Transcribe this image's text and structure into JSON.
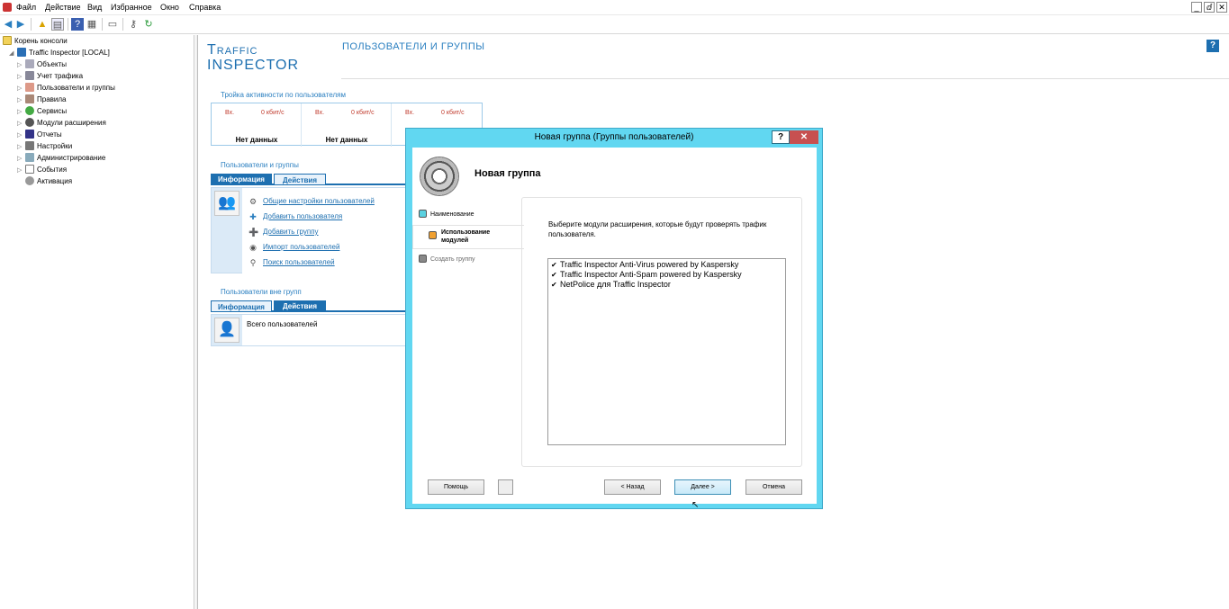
{
  "menubar": {
    "items": [
      "Файл",
      "Действие",
      "Вид",
      "Избранное",
      "Окно",
      "Справка"
    ],
    "window_controls": [
      "_",
      "ⅆ",
      "✕"
    ]
  },
  "tree": {
    "root": "Корень консоли",
    "server": "Traffic Inspector [LOCAL]",
    "items": [
      "Объекты",
      "Учет трафика",
      "Пользователи и группы",
      "Правила",
      "Сервисы",
      "Модули расширения",
      "Отчеты",
      "Настройки",
      "Администрирование",
      "События",
      "Активация"
    ]
  },
  "header": {
    "logo_line1": "Traffic",
    "logo_line2": "Inspector",
    "page_title": "ПОЛЬЗОВАТЕЛИ И ГРУППЫ",
    "help": "?"
  },
  "troika": {
    "title": "Тройка активности по пользователям",
    "cells": [
      {
        "vx": "Вх.",
        "speed": "0 кбит/с",
        "no_data": "Нет данных"
      },
      {
        "vx": "Вх.",
        "speed": "0 кбит/с",
        "no_data": "Нет данных"
      },
      {
        "vx": "Вх.",
        "speed": "0 кбит/с",
        "no_data": ""
      }
    ]
  },
  "users_groups": {
    "title": "Пользователи и группы",
    "tab_info": "Информация",
    "tab_actions": "Действия",
    "actions": [
      "Общие настройки пользователей",
      "Добавить пользователя",
      "Добавить группу",
      "Импорт пользователей",
      "Поиск пользователей"
    ]
  },
  "outside_groups": {
    "title": "Пользователи вне групп",
    "tab_info": "Информация",
    "tab_actions": "Действия",
    "total_users": "Всего пользователей"
  },
  "dialog": {
    "title": "Новая группа (Группы пользователей)",
    "help_btn": "?",
    "close_btn": "✕",
    "heading": "Новая группа",
    "steps": [
      {
        "label": "Наименование",
        "color": "#5ad1e0"
      },
      {
        "label": "Использование модулей",
        "color": "#f0a030"
      },
      {
        "label": "Создать группу",
        "color": "#888888"
      }
    ],
    "description": "Выберите модули расширения, которые будут проверять трафик пользователя.",
    "modules": [
      "Traffic Inspector Anti-Virus powered by Kaspersky",
      "Traffic Inspector Anti-Spam powered by Kaspersky",
      "NetPolice для Traffic Inspector"
    ],
    "buttons": {
      "help": "Помощь",
      "back": "< Назад",
      "next": "Далее >",
      "cancel": "Отмена"
    }
  }
}
